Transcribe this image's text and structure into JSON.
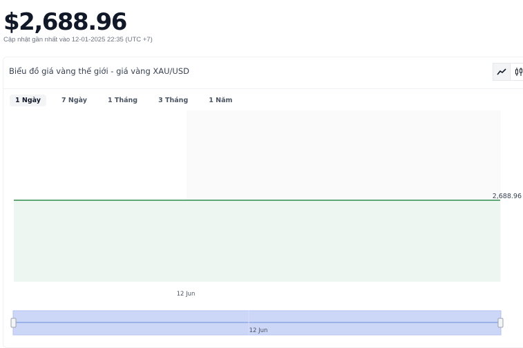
{
  "header": {
    "price": "$2,688.96",
    "updated": "Cập nhật gần nhất vào 12-01-2025 22:35 (UTC +7)"
  },
  "card": {
    "title": "Biểu đồ giá vàng thế giới - giá vàng XAU/USD",
    "tools": [
      {
        "icon": "line-chart-icon",
        "active": true
      },
      {
        "icon": "candlestick-icon",
        "active": false
      }
    ]
  },
  "tabs": [
    {
      "label": "1 Ngày",
      "active": true
    },
    {
      "label": "7 Ngày",
      "active": false
    },
    {
      "label": "1 Tháng",
      "active": false
    },
    {
      "label": "3 Tháng",
      "active": false
    },
    {
      "label": "1 Năm",
      "active": false
    }
  ],
  "chart_data": {
    "type": "area",
    "x": [
      "12 Jun",
      "12 Jun"
    ],
    "series": [
      {
        "values": [
          2688.96,
          2688.96
        ]
      }
    ],
    "last_value_label": "2,688.96",
    "x_tick_labels": [
      "12 Jun"
    ],
    "navigator_label": "12 Jun",
    "grid": false,
    "line_color": "#2e8b4a",
    "area_color": "#edf6f0",
    "navigator_color": "#ccd6f7"
  }
}
